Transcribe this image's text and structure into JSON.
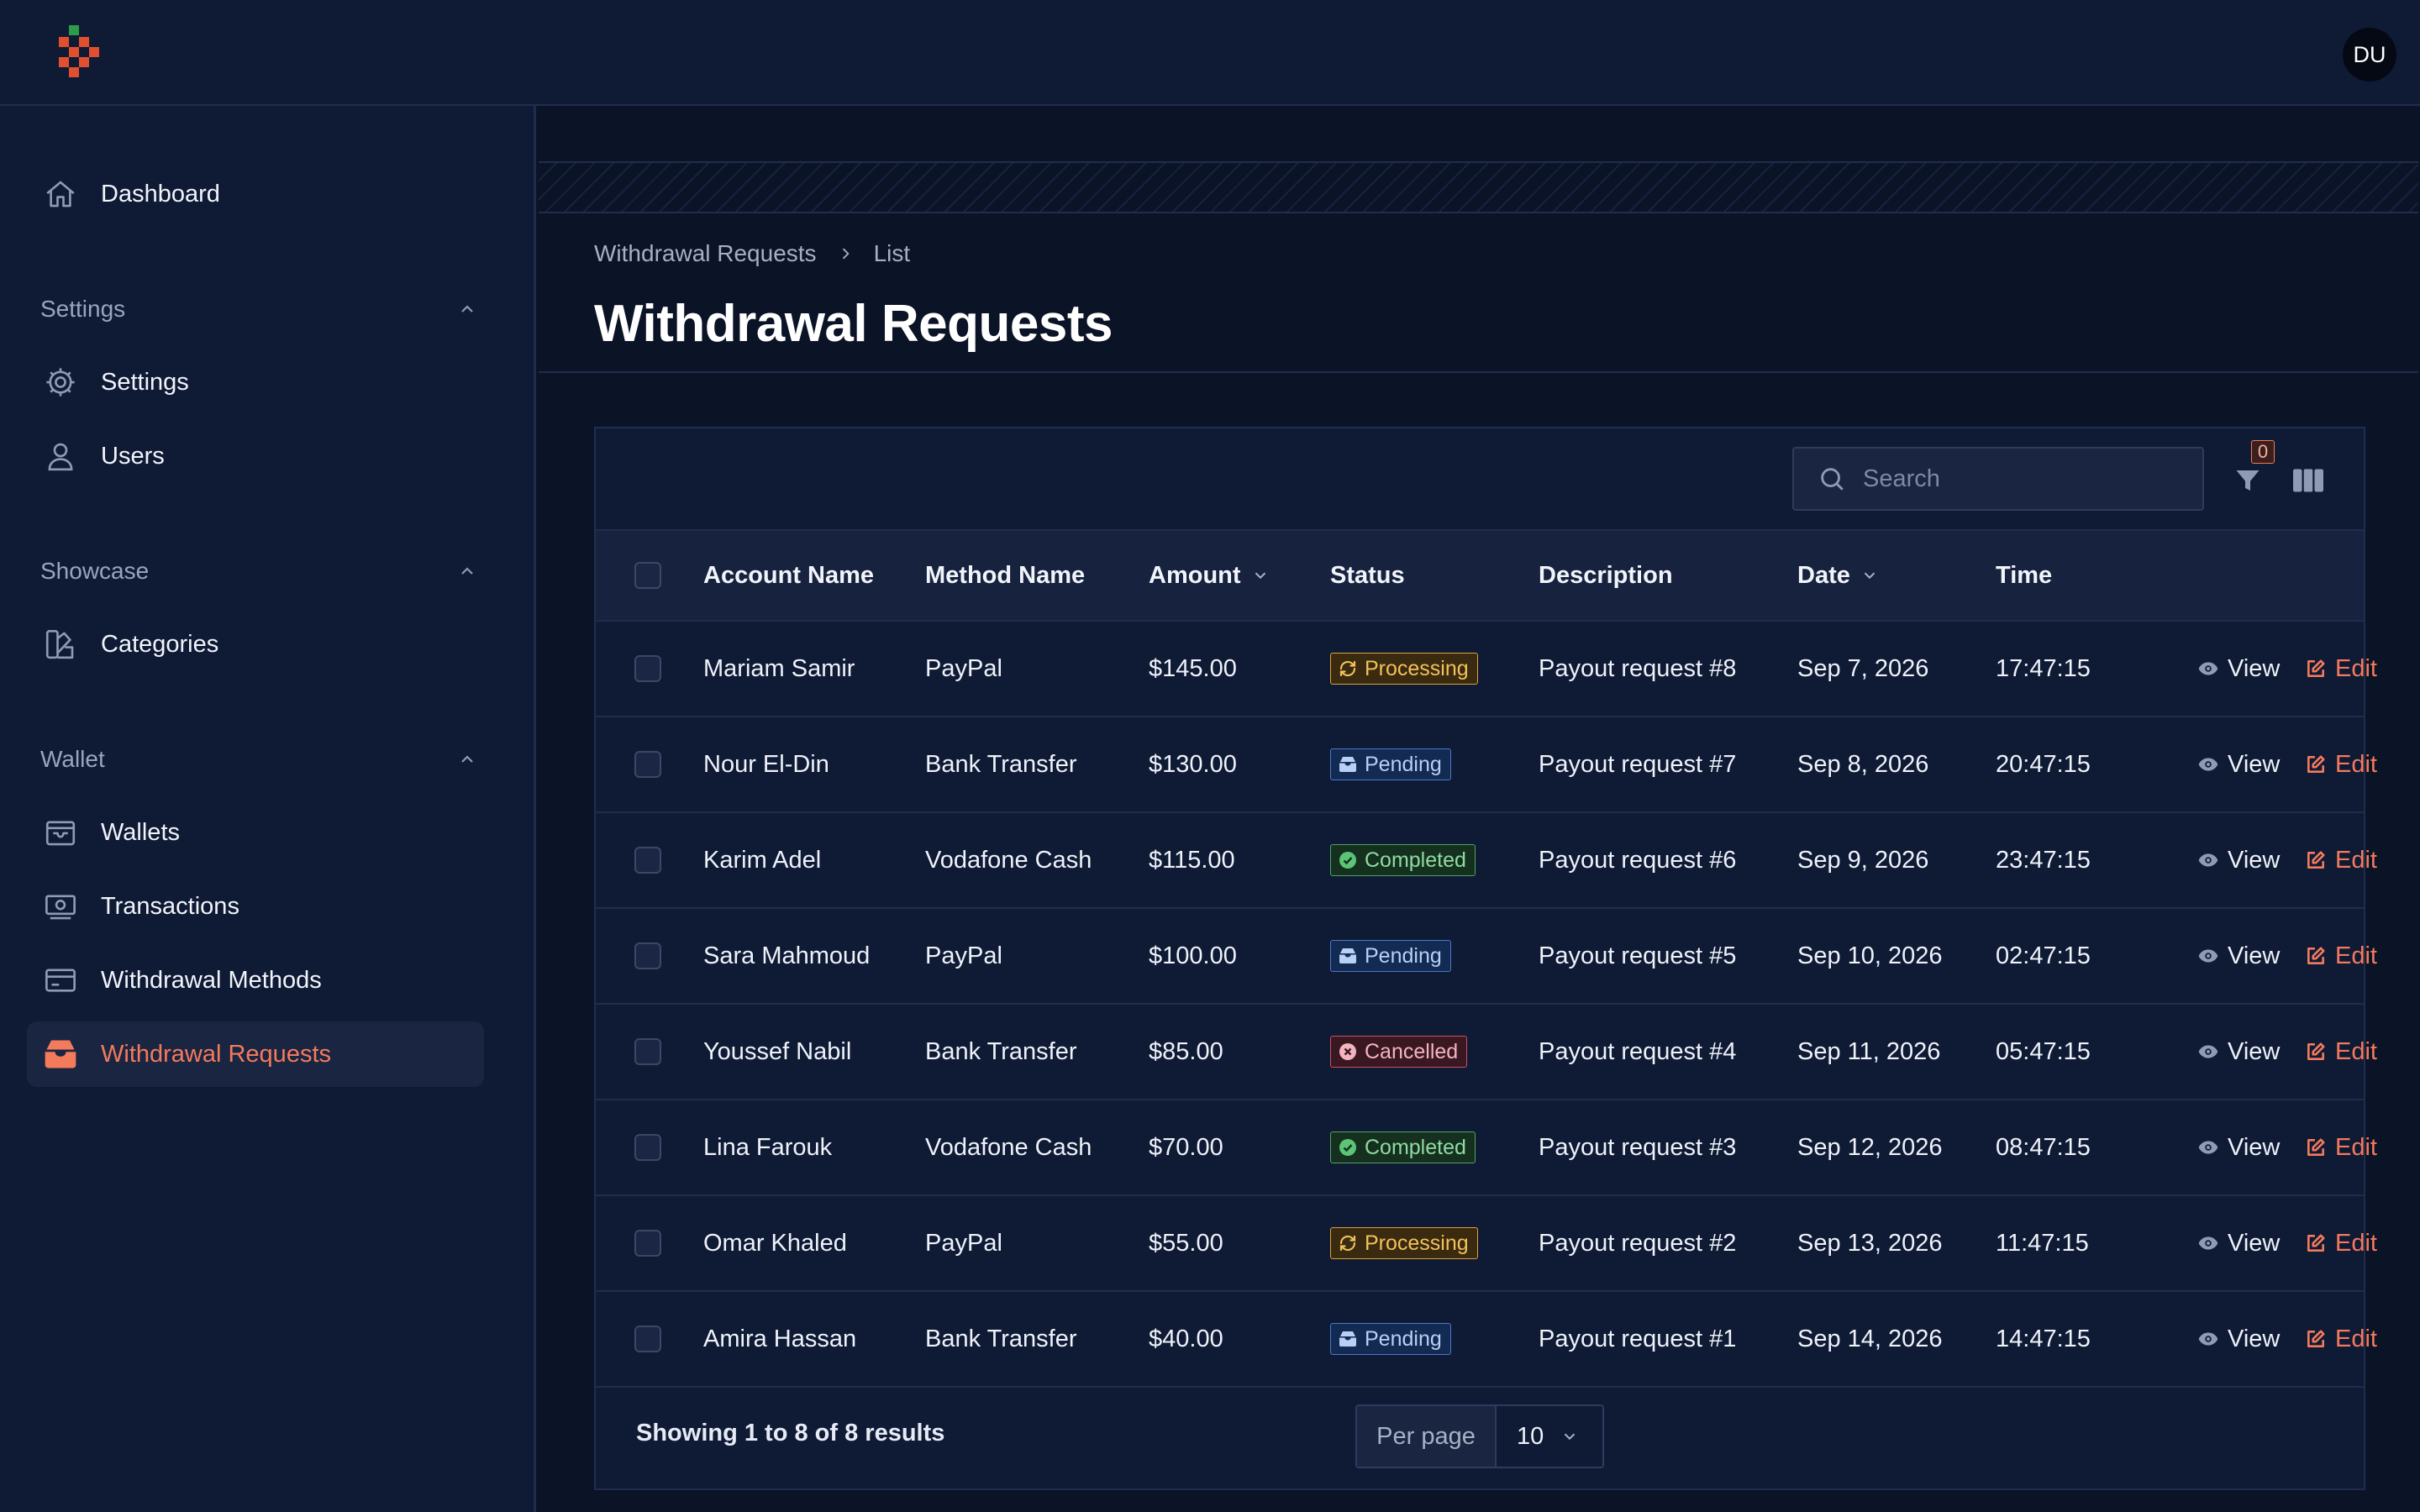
{
  "app": {
    "avatar_initials": "DU",
    "accent_color": "#f47a5c"
  },
  "sidebar": {
    "top_items": [
      {
        "label": "Dashboard",
        "icon": "home-icon"
      }
    ],
    "groups": [
      {
        "label": "Settings",
        "items": [
          {
            "label": "Settings",
            "icon": "gear-icon"
          },
          {
            "label": "Users",
            "icon": "user-icon"
          }
        ]
      },
      {
        "label": "Showcase",
        "items": [
          {
            "label": "Categories",
            "icon": "swatch-icon"
          }
        ]
      },
      {
        "label": "Wallet",
        "items": [
          {
            "label": "Wallets",
            "icon": "wallet-icon"
          },
          {
            "label": "Transactions",
            "icon": "cash-icon"
          },
          {
            "label": "Withdrawal Methods",
            "icon": "credit-card-icon"
          },
          {
            "label": "Withdrawal Requests",
            "icon": "inbox-stack-icon",
            "active": true
          }
        ]
      }
    ]
  },
  "breadcrumb": {
    "parent": "Withdrawal Requests",
    "current": "List"
  },
  "page": {
    "title": "Withdrawal Requests"
  },
  "toolbar": {
    "search_placeholder": "Search",
    "filter_count": "0"
  },
  "table": {
    "columns": [
      "Account Name",
      "Method Name",
      "Amount",
      "Status",
      "Description",
      "Date",
      "Time"
    ],
    "actions": {
      "view": "View",
      "edit": "Edit"
    },
    "rows": [
      {
        "account": "Mariam Samir",
        "method": "PayPal",
        "amount": "$145.00",
        "status": "Processing",
        "description": "Payout request #8",
        "date": "Sep 7, 2026",
        "time": "17:47:15"
      },
      {
        "account": "Nour El-Din",
        "method": "Bank Transfer",
        "amount": "$130.00",
        "status": "Pending",
        "description": "Payout request #7",
        "date": "Sep 8, 2026",
        "time": "20:47:15"
      },
      {
        "account": "Karim Adel",
        "method": "Vodafone Cash",
        "amount": "$115.00",
        "status": "Completed",
        "description": "Payout request #6",
        "date": "Sep 9, 2026",
        "time": "23:47:15"
      },
      {
        "account": "Sara Mahmoud",
        "method": "PayPal",
        "amount": "$100.00",
        "status": "Pending",
        "description": "Payout request #5",
        "date": "Sep 10, 2026",
        "time": "02:47:15"
      },
      {
        "account": "Youssef Nabil",
        "method": "Bank Transfer",
        "amount": "$85.00",
        "status": "Cancelled",
        "description": "Payout request #4",
        "date": "Sep 11, 2026",
        "time": "05:47:15"
      },
      {
        "account": "Lina Farouk",
        "method": "Vodafone Cash",
        "amount": "$70.00",
        "status": "Completed",
        "description": "Payout request #3",
        "date": "Sep 12, 2026",
        "time": "08:47:15"
      },
      {
        "account": "Omar Khaled",
        "method": "PayPal",
        "amount": "$55.00",
        "status": "Processing",
        "description": "Payout request #2",
        "date": "Sep 13, 2026",
        "time": "11:47:15"
      },
      {
        "account": "Amira Hassan",
        "method": "Bank Transfer",
        "amount": "$40.00",
        "status": "Pending",
        "description": "Payout request #1",
        "date": "Sep 14, 2026",
        "time": "14:47:15"
      }
    ]
  },
  "footer": {
    "showing": "Showing 1 to 8 of 8 results",
    "per_page_label": "Per page",
    "per_page_value": "10"
  }
}
